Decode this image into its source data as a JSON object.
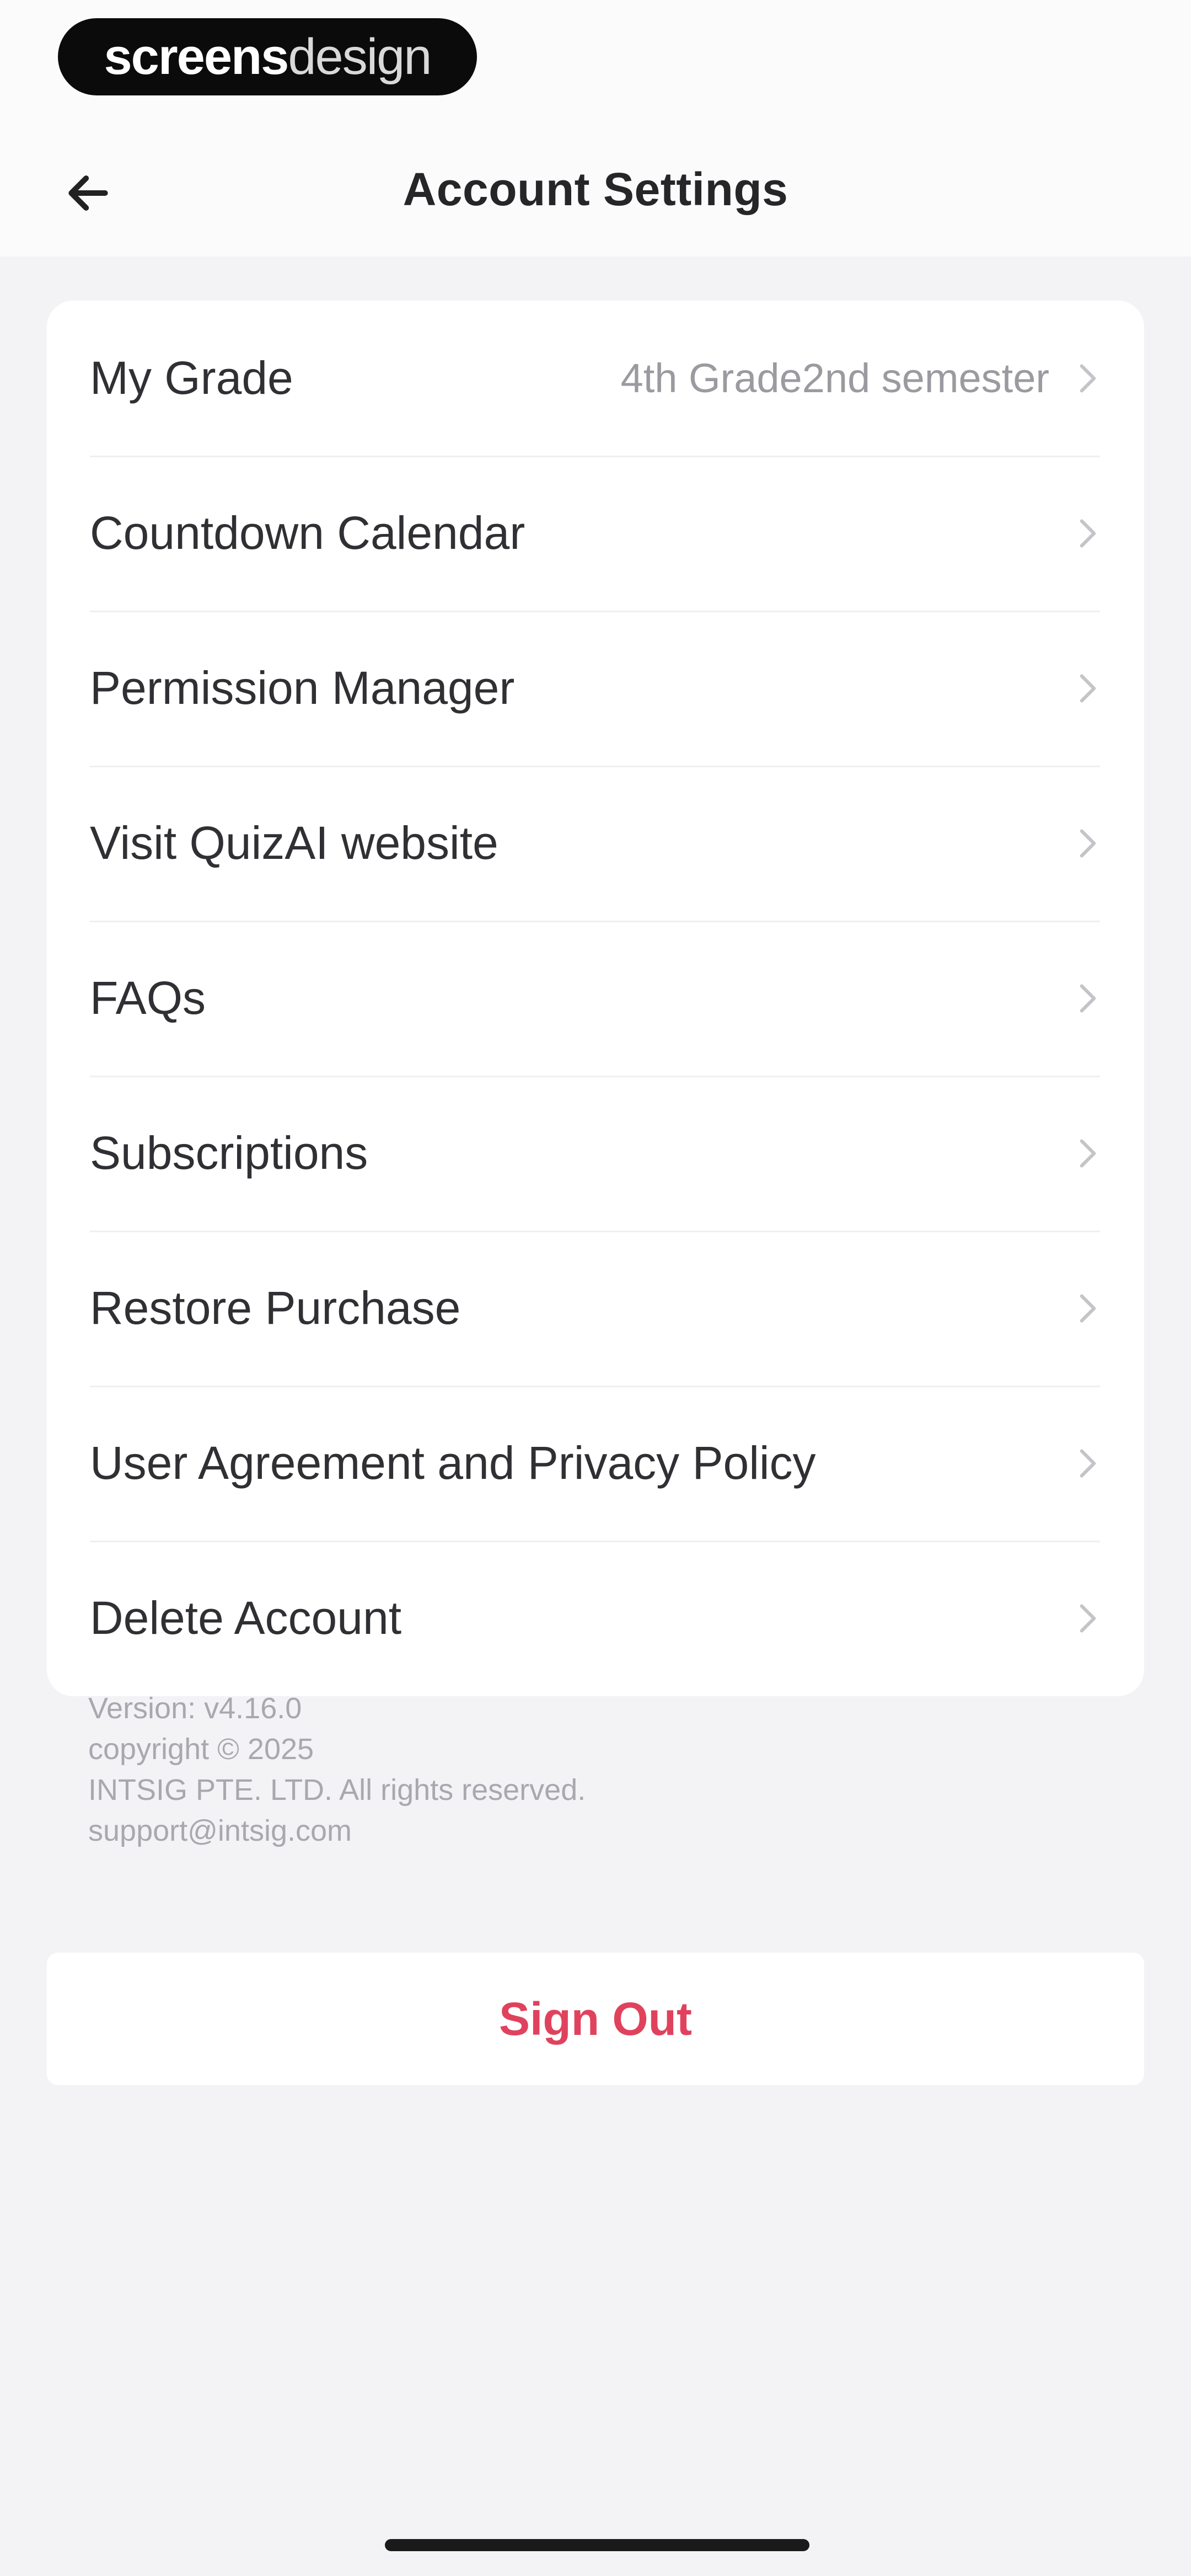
{
  "watermark": {
    "bold": "screens",
    "light": "design"
  },
  "header": {
    "back_icon": "arrow-left-icon",
    "title": "Account Settings"
  },
  "settings": {
    "items": [
      {
        "label": "My Grade",
        "value": "4th Grade2nd semester"
      },
      {
        "label": "Countdown Calendar"
      },
      {
        "label": "Permission Manager"
      },
      {
        "label": "Visit QuizAI website"
      },
      {
        "label": "FAQs"
      },
      {
        "label": "Subscriptions"
      },
      {
        "label": "Restore Purchase"
      },
      {
        "label": "User Agreement and Privacy Policy"
      },
      {
        "label": "Delete Account"
      }
    ],
    "chevron_icon": "chevron-right-icon"
  },
  "info": {
    "version": "Version: v4.16.0",
    "copyright": "copyright © 2025",
    "company": "INTSIG PTE. LTD. All rights reserved.",
    "email": "support@intsig.com"
  },
  "sign_out": {
    "label": "Sign Out",
    "color": "#e0425d"
  },
  "colors": {
    "background": "#f3f3f6",
    "card": "#ffffff",
    "accent_red": "#e0425d"
  }
}
